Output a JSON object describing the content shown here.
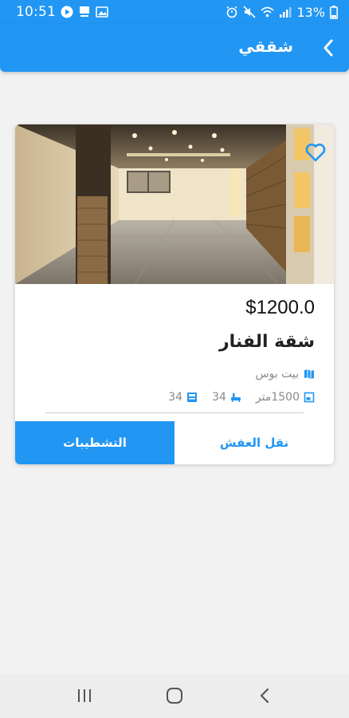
{
  "status_bar": {
    "time": "10:51",
    "battery_text": "13%",
    "icons_left": [
      "play-circle-icon",
      "kbs-indicator-icon",
      "image-icon"
    ],
    "icons_right": [
      "alarm-icon",
      "mute-icon",
      "wifi-icon",
      "signal-icon",
      "battery-icon"
    ]
  },
  "app_bar": {
    "title": "شققي",
    "back_icon": "chevron-right-icon"
  },
  "listing": {
    "price": "$1200.0",
    "title": "شقة الفنار",
    "location": "بيت بوس",
    "area": "1500متر",
    "bedrooms": "34",
    "bathrooms": "34",
    "favorite_icon": "heart-outline-icon",
    "actions": {
      "primary": "التشطيبات",
      "secondary": "نقل العفش"
    }
  },
  "nav_bar": {
    "buttons": [
      "recent-apps-icon",
      "home-icon",
      "back-icon"
    ]
  },
  "colors": {
    "primary": "#2196f3",
    "background": "#f2f2f2",
    "muted_text": "#8a8a8a"
  }
}
